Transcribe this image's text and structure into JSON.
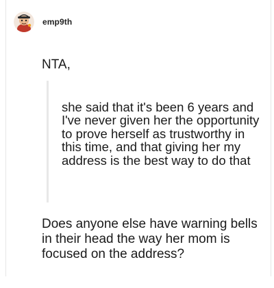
{
  "post": {
    "username": "emp9th",
    "avatar_icon": "cartoon-avatar-icon",
    "opening_line": "NTA,",
    "quote": "she said that it's been 6 years and I've never given her the opportunity to prove herself as trustworthy in this time, and that giving her my address is the best way to do that",
    "reply": "Does anyone else have warning bells in their head the way her mom is focused on the address?"
  },
  "colors": {
    "text": "#1a1a1a",
    "quote_bar": "#e8e8e8",
    "border": "#e6e6e6"
  }
}
